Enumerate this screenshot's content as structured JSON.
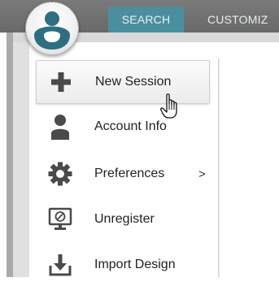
{
  "tabs": [
    {
      "label": "SEARCH"
    },
    {
      "label": "CUSTOMIZ"
    }
  ],
  "menu": {
    "items": [
      {
        "label": "New Session",
        "icon": "plus-icon"
      },
      {
        "label": "Account Info",
        "icon": "person-icon"
      },
      {
        "label": "Preferences",
        "icon": "gear-icon",
        "submenu_arrow": ">"
      },
      {
        "label": "Unregister",
        "icon": "monitor-ban-icon"
      },
      {
        "label": "Import Design",
        "icon": "import-icon"
      }
    ]
  },
  "colors": {
    "topbar": "#6f6f6f",
    "active_tab": "#4b8f9f",
    "icon": "#4a4a4a"
  }
}
